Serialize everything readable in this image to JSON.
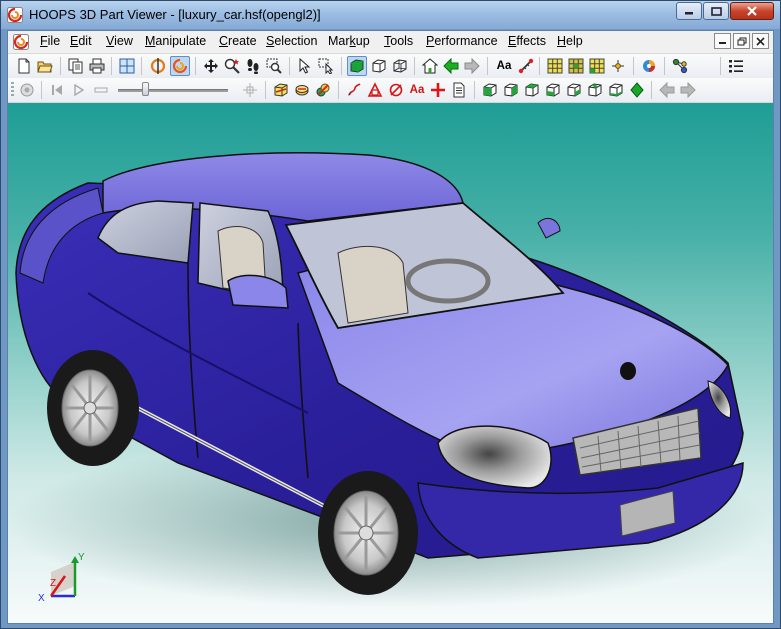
{
  "window": {
    "title": "HOOPS 3D Part Viewer - [luxury_car.hsf(opengl2)]",
    "caption_buttons": [
      "minimize-icon",
      "maximize-icon",
      "close-icon"
    ]
  },
  "menu": {
    "items": [
      {
        "key": "F",
        "rest": "ile"
      },
      {
        "key": "E",
        "rest": "dit"
      },
      {
        "key": "V",
        "rest": "iew"
      },
      {
        "key": "M",
        "rest": "anipulate"
      },
      {
        "key": "C",
        "rest": "reate"
      },
      {
        "key": "S",
        "rest": "election"
      },
      {
        "pre": "Mar",
        "key": "k",
        "rest": "up"
      },
      {
        "key": "T",
        "rest": "ools"
      },
      {
        "key": "P",
        "rest": "erformance"
      },
      {
        "key": "E",
        "rest": "ffects"
      },
      {
        "key": "H",
        "rest": "elp"
      }
    ]
  },
  "toolbar": {
    "text_tool_label": "Aa",
    "markup_text_label": "Aa"
  },
  "axis_triad": {
    "x": "X",
    "y": "Y",
    "z": "Z"
  },
  "colors": {
    "car_body": "#3b2fb5",
    "car_highlight": "#9f9cf0",
    "viewport_top": "#1e9e95",
    "viewport_bottom": "#f7fbfb",
    "axis_x": "#2a2ad8",
    "axis_y": "#1a9a2a",
    "axis_z": "#d21818"
  }
}
